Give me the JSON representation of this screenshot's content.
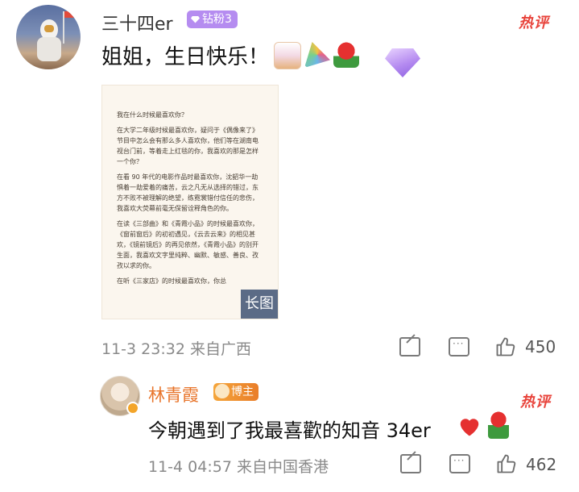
{
  "comment": {
    "username": "三十四er",
    "badge": "钻粉3",
    "hot_tag": "热评",
    "text": "姐姐，生日快乐！",
    "emojis": [
      "birthday-cake",
      "party-popper",
      "rose"
    ],
    "long_image_tag": "长图",
    "long_image_lines": [
      "我在什么时候最喜欢你？",
      "在大学二年级时候最喜欢你，疑问于《偶像来了》节目中怎么会有那么多人喜欢你，他们等在湖南电视台门前，等着走上红毯的你，我喜欢的那是怎样一个你？",
      "在看 90 年代的电影作品时最喜欢你，沈韶华一劫惧着一劫爱着的痛苦，云之凡无从选择的错过，东方不败不被理解的绝望，练霓裳错付信任的悲伤，我喜欢大荧幕前毫无保留诠释角色的你。",
      "在读《三部曲》和《青霞小品》的时候最喜欢你，《窗前窗后》的初初遇见，《云去云来》的相见甚欢，《镜前镜后》的再见依然，《青霞小品》的别开生面，我喜欢文字里纯粹、幽默、敏感、善良、孜孜以求的你。",
      "在听《三家店》的时候最喜欢你，你总"
    ],
    "timestamp": "11-3 23:32",
    "source": "来自广西",
    "likes": "450"
  },
  "reply": {
    "username": "林青霞",
    "badge": "博主",
    "hot_tag": "热评",
    "text": "今朝遇到了我最喜歡的知音 34er",
    "emojis": [
      "red-heart",
      "rose"
    ],
    "timestamp": "11-4 04:57",
    "source": "来自中国香港",
    "likes": "462"
  }
}
